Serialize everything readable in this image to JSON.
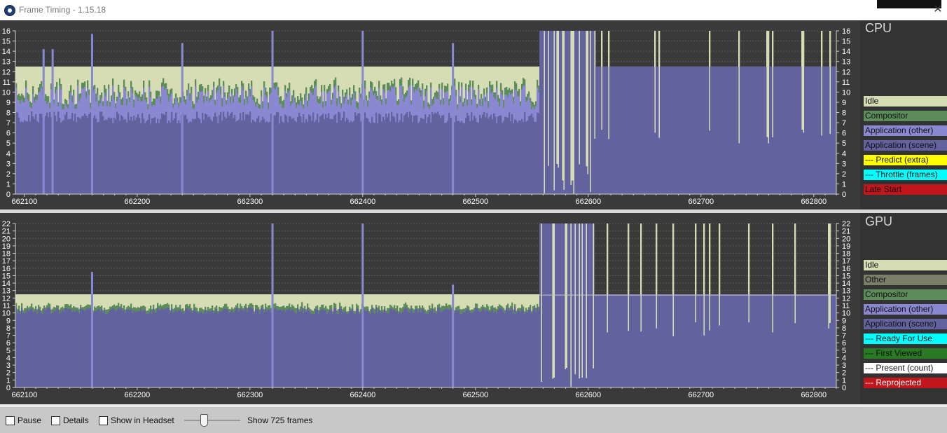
{
  "window": {
    "title": "Frame Timing - 1.15.18",
    "close_glyph": "✕"
  },
  "colors": {
    "idle": "#d6dcb4",
    "other": "#7b7f6a",
    "compositor": "#5b8c5a",
    "app_other": "#8b88d2",
    "app_scene": "#62629f",
    "predict": "#ffff00",
    "throttle": "#00ffff",
    "late_start": "#c2161d",
    "ready_for_use": "#00ffff",
    "first_viewed": "#2a7a25",
    "present": "#ffffff",
    "reprojected": "#c2161d"
  },
  "cpu": {
    "title": "CPU",
    "legend": [
      {
        "label": "Idle",
        "bg": "#d6dcb4",
        "fg": "#111111"
      },
      {
        "label": "Compositor",
        "bg": "#5b8c5a",
        "fg": "#111111"
      },
      {
        "label": "Application (other)",
        "bg": "#8b88d2",
        "fg": "#111111"
      },
      {
        "label": "Application (scene)",
        "bg": "#62629f",
        "fg": "#111111"
      },
      {
        "label": "--- Predict (extra)",
        "bg": "#ffff00",
        "fg": "#111111"
      },
      {
        "label": "--- Throttle (frames)",
        "bg": "#00ffff",
        "fg": "#111111"
      },
      {
        "label": "Late Start",
        "bg": "#c2161d",
        "fg": "#111111"
      }
    ]
  },
  "gpu": {
    "title": "GPU",
    "legend": [
      {
        "label": "Idle",
        "bg": "#d6dcb4",
        "fg": "#111111"
      },
      {
        "label": "Other",
        "bg": "#7b7f6a",
        "fg": "#111111"
      },
      {
        "label": "Compositor",
        "bg": "#5b8c5a",
        "fg": "#111111"
      },
      {
        "label": "Application (other)",
        "bg": "#8b88d2",
        "fg": "#111111"
      },
      {
        "label": "Application (scene)",
        "bg": "#62629f",
        "fg": "#111111"
      },
      {
        "label": "--- Ready For Use",
        "bg": "#00ffff",
        "fg": "#111111"
      },
      {
        "label": "--- First Viewed",
        "bg": "#2a7a25",
        "fg": "#111111"
      },
      {
        "label": "--- Present (count)",
        "bg": "#ffffff",
        "fg": "#111111"
      },
      {
        "label": "--- Reprojected",
        "bg": "#c2161d",
        "fg": "#ffffff"
      }
    ]
  },
  "chart_data": [
    {
      "type": "area",
      "title": "CPU",
      "x_ticks": [
        "662100",
        "662200",
        "662300",
        "662400",
        "662500",
        "662600",
        "662700",
        "662800"
      ],
      "x_tick_values": [
        662100,
        662200,
        662300,
        662400,
        662500,
        662600,
        662700,
        662800
      ],
      "xlim": [
        662092,
        662820
      ],
      "ylim": [
        0,
        16
      ],
      "y_ticks": [
        0,
        1,
        2,
        3,
        4,
        5,
        6,
        7,
        8,
        9,
        10,
        11,
        12,
        13,
        14,
        15,
        16
      ],
      "frame_budget": 12.5,
      "segments": [
        {
          "range": [
            662092,
            662556
          ],
          "scene": 7.5,
          "other": 9.5,
          "compositor": 10.2,
          "idle": 12.5
        },
        {
          "range": [
            662556,
            662605
          ],
          "pattern": "spiky",
          "scene": 16,
          "idle": 16
        },
        {
          "range": [
            662605,
            662820
          ],
          "pattern": "saturated",
          "scene": 16,
          "idle": 12.5
        }
      ],
      "spikes": [
        {
          "x": 662117,
          "y": 14.2
        },
        {
          "x": 662125,
          "y": 14.2
        },
        {
          "x": 662160,
          "y": 15.7
        },
        {
          "x": 662240,
          "y": 14.8
        },
        {
          "x": 662320,
          "y": 16
        },
        {
          "x": 662400,
          "y": 16
        },
        {
          "x": 662480,
          "y": 14.8
        }
      ]
    },
    {
      "type": "area",
      "title": "GPU",
      "x_ticks": [
        "662100",
        "662200",
        "662300",
        "662400",
        "662500",
        "662600",
        "662700",
        "662800"
      ],
      "x_tick_values": [
        662100,
        662200,
        662300,
        662400,
        662500,
        662600,
        662700,
        662800
      ],
      "xlim": [
        662092,
        662820
      ],
      "ylim": [
        0,
        22
      ],
      "y_ticks": [
        0,
        1,
        2,
        3,
        4,
        5,
        6,
        7,
        8,
        9,
        10,
        11,
        12,
        13,
        14,
        15,
        16,
        17,
        18,
        19,
        20,
        21,
        22
      ],
      "frame_budget": 12.5,
      "segments": [
        {
          "range": [
            662092,
            662556
          ],
          "scene": 10.3,
          "compositor": 10.8,
          "idle": 12.5
        },
        {
          "range": [
            662556,
            662605
          ],
          "pattern": "spiky",
          "scene": 22,
          "idle": 22
        },
        {
          "range": [
            662605,
            662820
          ],
          "pattern": "saturated",
          "scene": 22,
          "idle": 12.5
        }
      ],
      "spikes": [
        {
          "x": 662160,
          "y": 15.5
        },
        {
          "x": 662320,
          "y": 22
        },
        {
          "x": 662400,
          "y": 22
        },
        {
          "x": 662480,
          "y": 13.8
        }
      ]
    }
  ],
  "controls": {
    "pause_label": "Pause",
    "details_label": "Details",
    "show_in_headset_label": "Show in Headset",
    "show_frames_label": "Show 725 frames",
    "frames_shown": 725
  }
}
